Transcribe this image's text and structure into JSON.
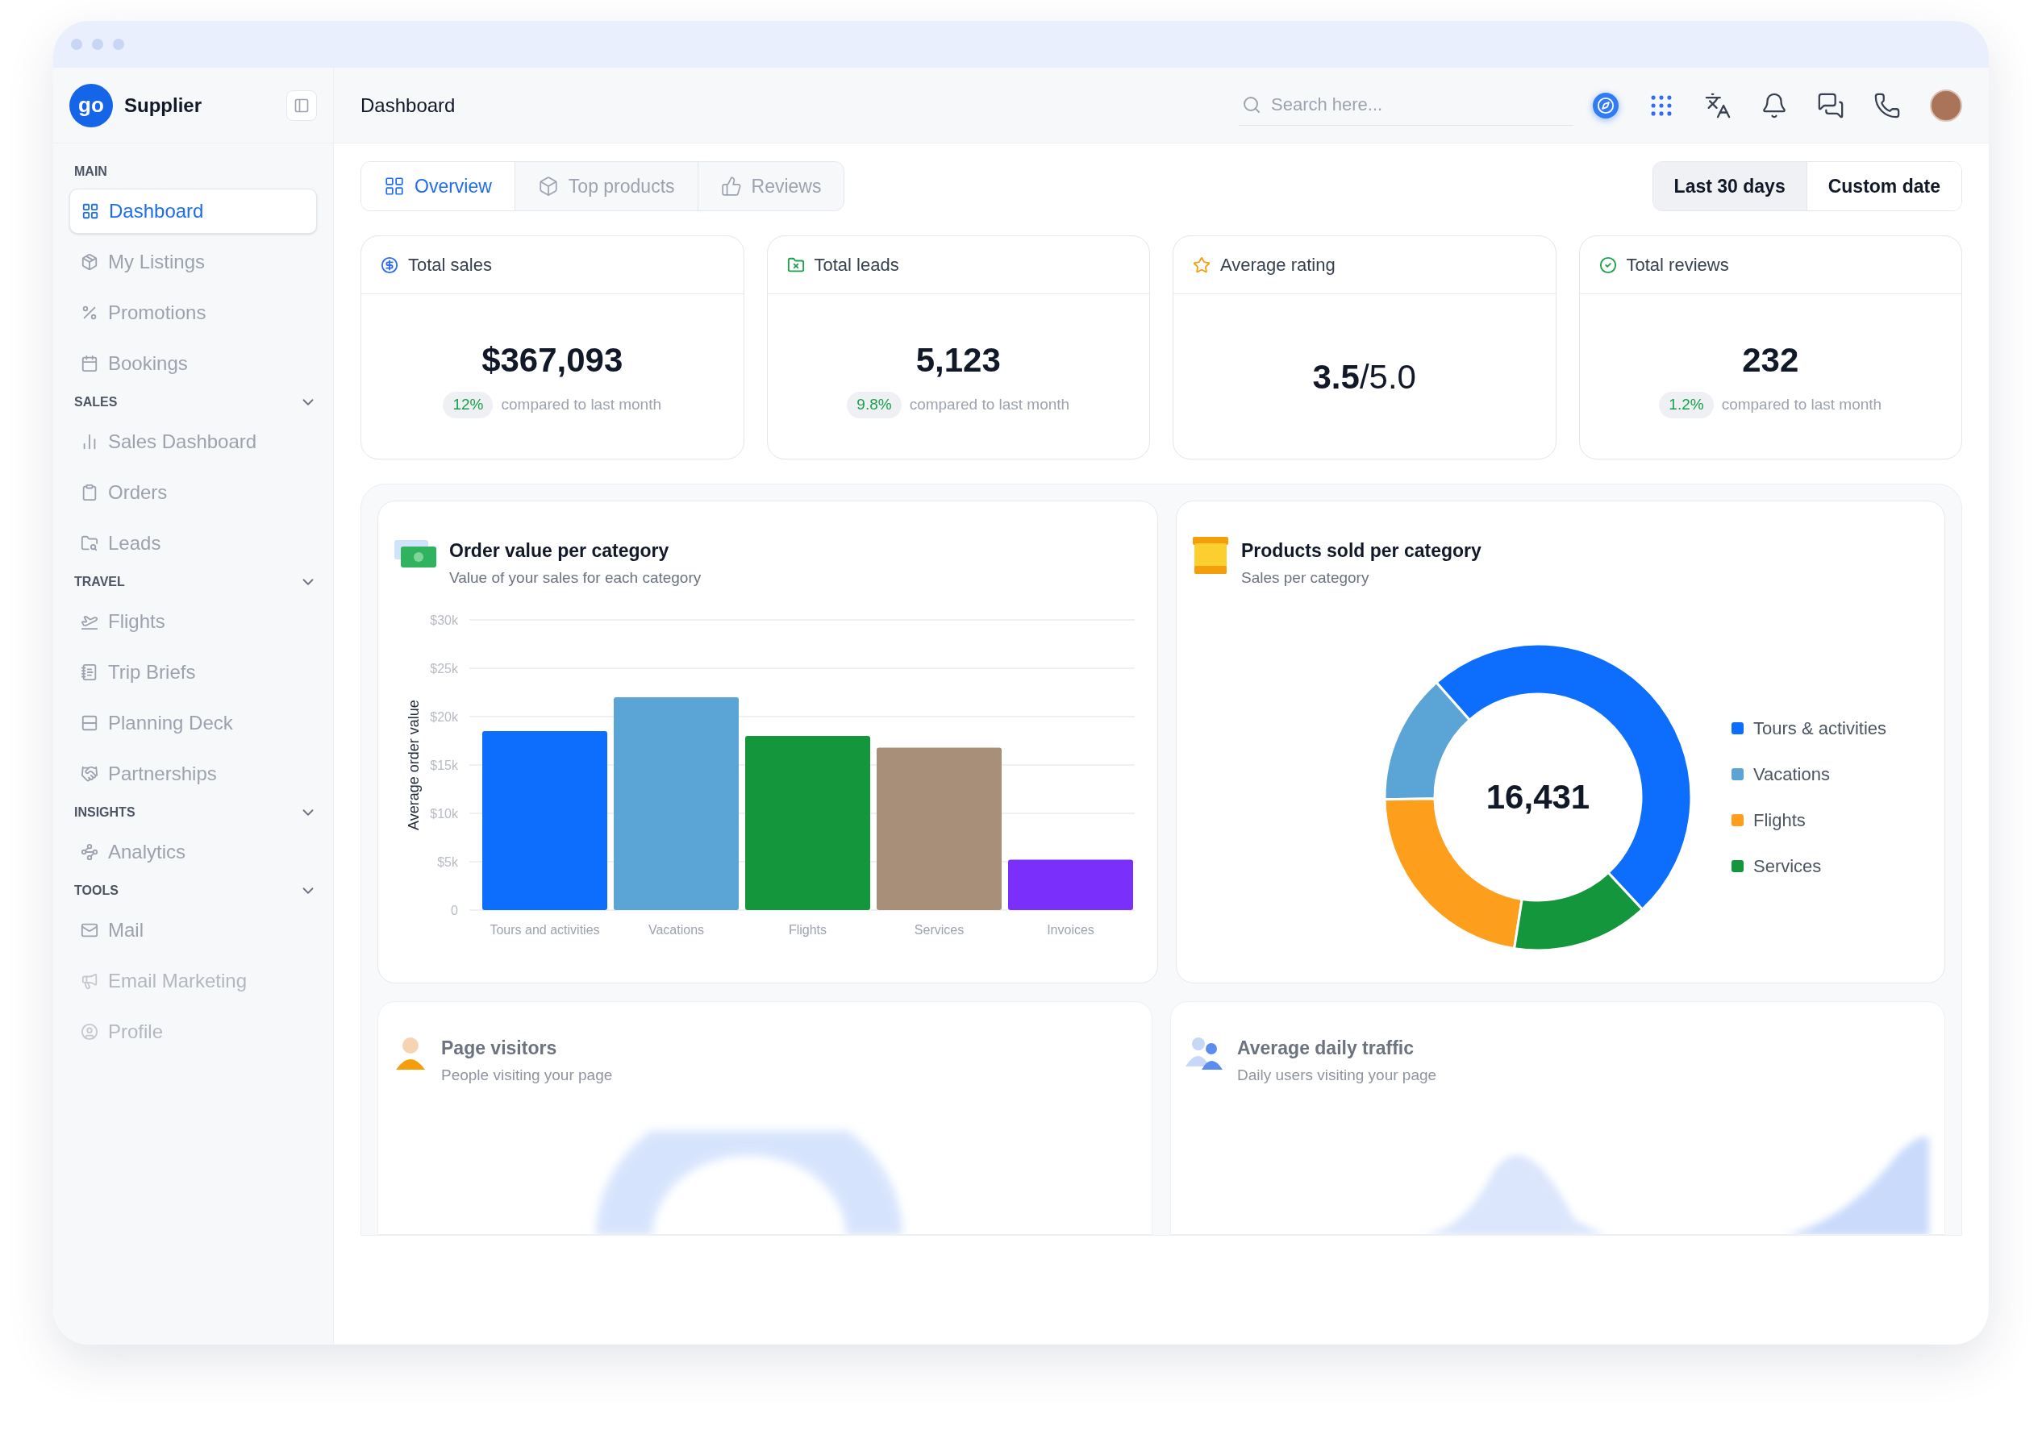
{
  "sidebar": {
    "logo_text": "go",
    "brand": "Supplier",
    "sections": [
      {
        "label": "MAIN",
        "items": [
          {
            "label": "Dashboard",
            "selected": true,
            "dimmed": false
          },
          {
            "label": "My Listings",
            "selected": false,
            "dimmed": false
          },
          {
            "label": "Promotions",
            "selected": false,
            "dimmed": false
          },
          {
            "label": "Bookings",
            "selected": false,
            "dimmed": false
          }
        ]
      },
      {
        "label": "SALES",
        "expanded": true,
        "items": [
          {
            "label": "Sales Dashboard",
            "selected": false,
            "dimmed": false
          },
          {
            "label": "Orders",
            "selected": false,
            "dimmed": false
          },
          {
            "label": "Leads",
            "selected": false,
            "dimmed": false
          }
        ]
      },
      {
        "label": "TRAVEL",
        "expanded": true,
        "items": [
          {
            "label": "Flights",
            "selected": false,
            "dimmed": false
          },
          {
            "label": "Trip Briefs",
            "selected": false,
            "dimmed": false
          },
          {
            "label": "Planning Deck",
            "selected": false,
            "dimmed": false
          },
          {
            "label": "Partnerships",
            "selected": false,
            "dimmed": false
          }
        ]
      },
      {
        "label": "INSIGHTS",
        "expanded": true,
        "items": [
          {
            "label": "Analytics",
            "selected": false,
            "dimmed": false
          }
        ]
      },
      {
        "label": "TOOLS",
        "expanded": true,
        "items": [
          {
            "label": "Mail",
            "selected": false,
            "dimmed": false
          },
          {
            "label": "Email Marketing",
            "selected": false,
            "dimmed": true
          },
          {
            "label": "Profile",
            "selected": false,
            "dimmed": true
          }
        ]
      }
    ]
  },
  "header": {
    "title": "Dashboard",
    "search": {
      "placeholder": "Search here..."
    }
  },
  "tabs": [
    {
      "label": "Overview",
      "selected": true
    },
    {
      "label": "Top products",
      "selected": false
    },
    {
      "label": "Reviews",
      "selected": false
    }
  ],
  "date_buttons": [
    {
      "label": "Last 30 days",
      "selected": true
    },
    {
      "label": "Custom date",
      "selected": false
    }
  ],
  "stats": [
    {
      "title": "Total sales",
      "value": "$367,093",
      "change": "12%",
      "note": "compared to last month"
    },
    {
      "title": "Total leads",
      "value": "5,123",
      "change": "9.8%",
      "note": "compared to last month"
    },
    {
      "title": "Average rating",
      "value": "**3.5**/5.0"
    },
    {
      "title": "Total reviews",
      "value": "232",
      "change": "1.2%",
      "note": "compared to last month"
    }
  ],
  "charts": [
    {
      "title": "Order value per category",
      "subtitle": "Value of your sales for each category",
      "chart_data": {
        "type": "bar",
        "ylabel": "Average order value",
        "grid": true,
        "categories": [
          "Tours and activities",
          "Vacations",
          "Flights",
          "Services",
          "Invoices"
        ],
        "values": [
          18500,
          22000,
          18000,
          16800,
          5200
        ],
        "colors": [
          "#0d6efd",
          "#5ba4d6",
          "#13963c",
          "#a88f7a",
          "#7a30fa"
        ],
        "ylim": [
          0,
          30000
        ],
        "yticks": [
          {
            "value": 0,
            "label": "0"
          },
          {
            "value": 5000,
            "label": "$5k"
          },
          {
            "value": 10000,
            "label": "$10k"
          },
          {
            "value": 15000,
            "label": "$15k"
          },
          {
            "value": 20000,
            "label": "$20k"
          },
          {
            "value": 25000,
            "label": "$25k"
          },
          {
            "value": 30000,
            "label": "$30k"
          }
        ]
      }
    },
    {
      "title": "Products sold per category",
      "subtitle": "Sales per category",
      "center_label": "16,431",
      "chart_data": {
        "type": "donut",
        "legend": true,
        "categories": [
          "Tours & activities",
          "Vacations",
          "Flights",
          "Services"
        ],
        "values": [
          49.6,
          13.7,
          22.3,
          14.4
        ],
        "colors": [
          "#0d6efd",
          "#5ba4d6",
          "#fd9f1c",
          "#13963c"
        ]
      }
    }
  ],
  "faded_cards": [
    {
      "title": "Page visitors",
      "subtitle": "People visiting your page"
    },
    {
      "title": "Average daily traffic",
      "subtitle": "Daily users visiting your page"
    }
  ]
}
